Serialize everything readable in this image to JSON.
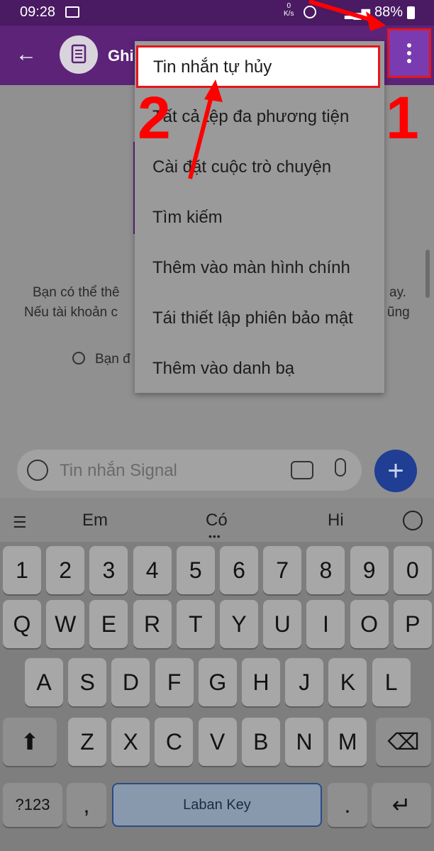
{
  "status_bar": {
    "time": "09:28",
    "speed_top": "0",
    "speed_unit": "K/s",
    "battery": "88%"
  },
  "app_bar": {
    "title": "Ghi"
  },
  "menu": {
    "items": [
      "Tin nhắn tự hủy",
      "Tất cả tệp đa phương tiện",
      "Cài đặt cuộc trò chuyện",
      "Tìm kiếm",
      "Thêm vào màn hình chính",
      "Tái thiết lập phiên bảo mật",
      "Thêm vào danh bạ"
    ]
  },
  "annotations": {
    "step1": "1",
    "step2": "2"
  },
  "chat": {
    "line1_left": "Bạn có thể thê",
    "line1_right": "ay.",
    "line2_left": "Nếu tài khoản c",
    "line2_right": "ũng",
    "timer_text": "Bạn đ"
  },
  "composer": {
    "placeholder": "Tin nhắn Signal"
  },
  "keyboard": {
    "suggestions": [
      "Em",
      "Có",
      "Hi"
    ],
    "row_numbers": [
      "1",
      "2",
      "3",
      "4",
      "5",
      "6",
      "7",
      "8",
      "9",
      "0"
    ],
    "row1": [
      "Q",
      "W",
      "E",
      "R",
      "T",
      "Y",
      "U",
      "I",
      "O",
      "P"
    ],
    "row2": [
      "A",
      "S",
      "D",
      "F",
      "G",
      "H",
      "J",
      "K",
      "L"
    ],
    "row3": [
      "Z",
      "X",
      "C",
      "V",
      "B",
      "N",
      "M"
    ],
    "symbols_key": "?123",
    "comma_key": ",",
    "space_label": "Laban Key",
    "period_key": "."
  },
  "colors": {
    "accent_purple": "#5c2379",
    "highlight_red": "#e4161c",
    "fab_blue": "#1f3e94"
  }
}
